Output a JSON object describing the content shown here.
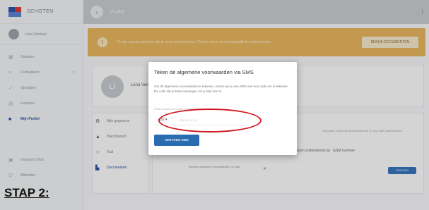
{
  "sidebar": {
    "brand_name": "SCHOTEN",
    "user_name": "Lena Vermeyl",
    "items": [
      {
        "label": "Dossiers",
        "icon": "grid-icon",
        "active": false
      },
      {
        "label": "Formulieren",
        "icon": "list-icon",
        "active": false
      },
      {
        "label": "Opvolgen",
        "icon": "check-icon",
        "active": false
      },
      {
        "label": "Facturen",
        "icon": "receipt-icon",
        "active": false
      },
      {
        "label": "Mijn Profiel",
        "icon": "folder-icon",
        "active": true
      }
    ],
    "bottom_items": [
      {
        "label": "Overzicht Shui",
        "icon": "box-icon"
      },
      {
        "label": "Afmelden",
        "icon": "power-icon"
      }
    ]
  },
  "topbar": {
    "title": "Profiel",
    "back_icon": "chevron-left-icon",
    "menu_label": "⁝"
  },
  "banner": {
    "icon": "!",
    "text": "Er zijn nog documenten die je moet ondertekenen. Gelieve deze zo snel mogelijk te ondertekenen.",
    "button_label": "BEKIJK DOCUMENTEN"
  },
  "profile": {
    "initials": "LI",
    "name": "Lena Vermeyl"
  },
  "menu": {
    "items": [
      {
        "label": "Mijn gegevens",
        "icon": "gear-icon",
        "active": false
      },
      {
        "label": "Wachtwoord",
        "icon": "lock-icon",
        "active": false
      },
      {
        "label": "Taal",
        "icon": "star-icon",
        "active": false
      },
      {
        "label": "Documenten",
        "icon": "document-icon",
        "active": true
      }
    ]
  },
  "docs": {
    "info": "Hieronder vind je de documenten die je nog moet ondertekenen.",
    "col_date": "Datum ondertekend op",
    "col_gsm": "GSM nummer",
    "row_text": "Tekenen algemene voorwaarden v1.0.pdf",
    "row_status": "✕",
    "row_button": "TEKENEN"
  },
  "modal": {
    "title": "Teken de algemene voorwaarden via SMS",
    "body": "Om de algemene voorwaarden te tekenen, sturen we je een SMS met een code om te tekenen. De code die je hebt ontvangen vul je dan hier in.",
    "field_label": "GSM nummer om code te ontvangen",
    "phone_prefix": "+32 ▾",
    "phone_placeholder": "4xx xx xx xx",
    "button_label": "ONTVANG SMS"
  },
  "step_label": "STAP 2:",
  "colors": {
    "banner": "#e6b35a",
    "primary": "#2a6cb0",
    "annotation": "#d1161e"
  }
}
